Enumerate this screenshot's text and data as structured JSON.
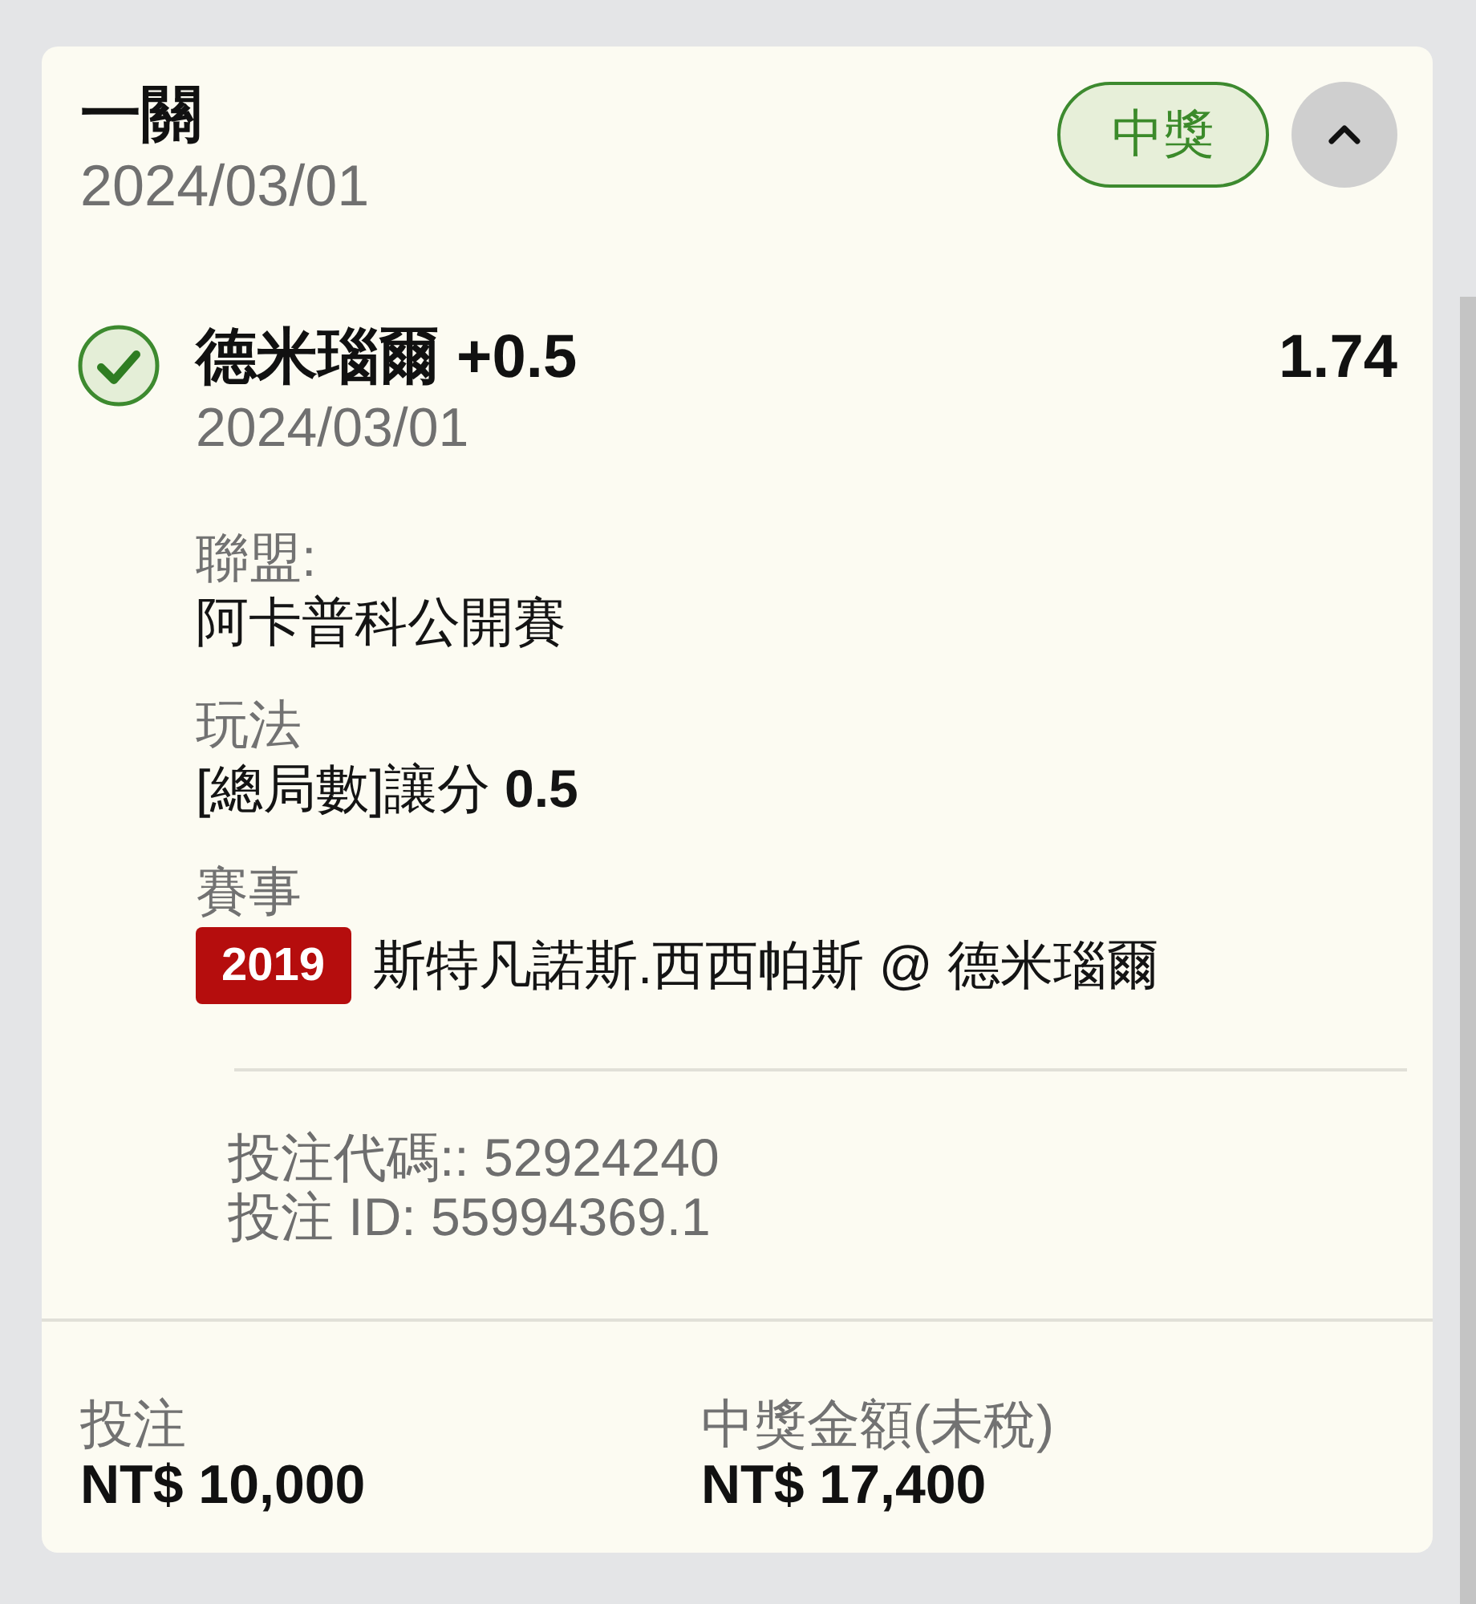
{
  "bet": {
    "title": "一關",
    "date": "2024/03/01",
    "status": {
      "label": "中獎",
      "kind": "won"
    },
    "expanded": true
  },
  "selection": {
    "won": true,
    "name": "德米瑙爾 +0.5",
    "odds": "1.74",
    "date": "2024/03/01",
    "details": [
      {
        "label": "聯盟:",
        "value": "阿卡普科公開賽"
      },
      {
        "label": "玩法",
        "value": "[總局數]讓分 **0.5**"
      },
      {
        "label": "賽事",
        "event_code": "2019",
        "value": "斯特凡諾斯.西西帕斯 @ 德米瑙爾"
      }
    ]
  },
  "codes": [
    "投注代碼:: 52924240",
    "投注 ID: 55994369.1"
  ],
  "totals": [
    {
      "label": "投注",
      "amount": "NT$ 10,000"
    },
    {
      "label": "中獎金額(未稅)",
      "amount": "NT$ 17,400"
    }
  ]
}
